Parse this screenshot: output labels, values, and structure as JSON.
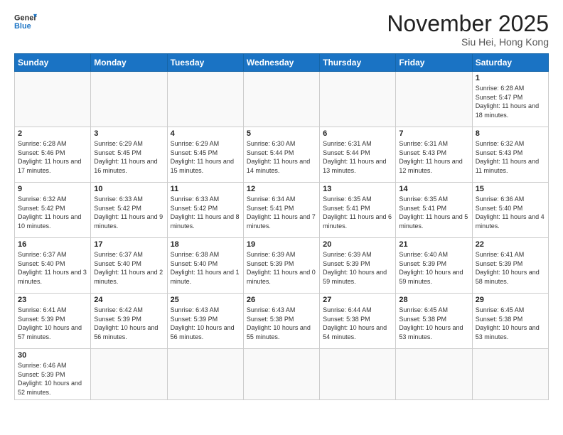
{
  "header": {
    "logo": "GeneralBlue",
    "title": "November 2025",
    "location": "Siu Hei, Hong Kong"
  },
  "days_of_week": [
    "Sunday",
    "Monday",
    "Tuesday",
    "Wednesday",
    "Thursday",
    "Friday",
    "Saturday"
  ],
  "weeks": [
    [
      {
        "day": "",
        "info": ""
      },
      {
        "day": "",
        "info": ""
      },
      {
        "day": "",
        "info": ""
      },
      {
        "day": "",
        "info": ""
      },
      {
        "day": "",
        "info": ""
      },
      {
        "day": "",
        "info": ""
      },
      {
        "day": "1",
        "info": "Sunrise: 6:28 AM\nSunset: 5:47 PM\nDaylight: 11 hours and 18 minutes."
      }
    ],
    [
      {
        "day": "2",
        "info": "Sunrise: 6:28 AM\nSunset: 5:46 PM\nDaylight: 11 hours and 17 minutes."
      },
      {
        "day": "3",
        "info": "Sunrise: 6:29 AM\nSunset: 5:45 PM\nDaylight: 11 hours and 16 minutes."
      },
      {
        "day": "4",
        "info": "Sunrise: 6:29 AM\nSunset: 5:45 PM\nDaylight: 11 hours and 15 minutes."
      },
      {
        "day": "5",
        "info": "Sunrise: 6:30 AM\nSunset: 5:44 PM\nDaylight: 11 hours and 14 minutes."
      },
      {
        "day": "6",
        "info": "Sunrise: 6:31 AM\nSunset: 5:44 PM\nDaylight: 11 hours and 13 minutes."
      },
      {
        "day": "7",
        "info": "Sunrise: 6:31 AM\nSunset: 5:43 PM\nDaylight: 11 hours and 12 minutes."
      },
      {
        "day": "8",
        "info": "Sunrise: 6:32 AM\nSunset: 5:43 PM\nDaylight: 11 hours and 11 minutes."
      }
    ],
    [
      {
        "day": "9",
        "info": "Sunrise: 6:32 AM\nSunset: 5:42 PM\nDaylight: 11 hours and 10 minutes."
      },
      {
        "day": "10",
        "info": "Sunrise: 6:33 AM\nSunset: 5:42 PM\nDaylight: 11 hours and 9 minutes."
      },
      {
        "day": "11",
        "info": "Sunrise: 6:33 AM\nSunset: 5:42 PM\nDaylight: 11 hours and 8 minutes."
      },
      {
        "day": "12",
        "info": "Sunrise: 6:34 AM\nSunset: 5:41 PM\nDaylight: 11 hours and 7 minutes."
      },
      {
        "day": "13",
        "info": "Sunrise: 6:35 AM\nSunset: 5:41 PM\nDaylight: 11 hours and 6 minutes."
      },
      {
        "day": "14",
        "info": "Sunrise: 6:35 AM\nSunset: 5:41 PM\nDaylight: 11 hours and 5 minutes."
      },
      {
        "day": "15",
        "info": "Sunrise: 6:36 AM\nSunset: 5:40 PM\nDaylight: 11 hours and 4 minutes."
      }
    ],
    [
      {
        "day": "16",
        "info": "Sunrise: 6:37 AM\nSunset: 5:40 PM\nDaylight: 11 hours and 3 minutes."
      },
      {
        "day": "17",
        "info": "Sunrise: 6:37 AM\nSunset: 5:40 PM\nDaylight: 11 hours and 2 minutes."
      },
      {
        "day": "18",
        "info": "Sunrise: 6:38 AM\nSunset: 5:40 PM\nDaylight: 11 hours and 1 minute."
      },
      {
        "day": "19",
        "info": "Sunrise: 6:39 AM\nSunset: 5:39 PM\nDaylight: 11 hours and 0 minutes."
      },
      {
        "day": "20",
        "info": "Sunrise: 6:39 AM\nSunset: 5:39 PM\nDaylight: 10 hours and 59 minutes."
      },
      {
        "day": "21",
        "info": "Sunrise: 6:40 AM\nSunset: 5:39 PM\nDaylight: 10 hours and 59 minutes."
      },
      {
        "day": "22",
        "info": "Sunrise: 6:41 AM\nSunset: 5:39 PM\nDaylight: 10 hours and 58 minutes."
      }
    ],
    [
      {
        "day": "23",
        "info": "Sunrise: 6:41 AM\nSunset: 5:39 PM\nDaylight: 10 hours and 57 minutes."
      },
      {
        "day": "24",
        "info": "Sunrise: 6:42 AM\nSunset: 5:39 PM\nDaylight: 10 hours and 56 minutes."
      },
      {
        "day": "25",
        "info": "Sunrise: 6:43 AM\nSunset: 5:39 PM\nDaylight: 10 hours and 56 minutes."
      },
      {
        "day": "26",
        "info": "Sunrise: 6:43 AM\nSunset: 5:38 PM\nDaylight: 10 hours and 55 minutes."
      },
      {
        "day": "27",
        "info": "Sunrise: 6:44 AM\nSunset: 5:38 PM\nDaylight: 10 hours and 54 minutes."
      },
      {
        "day": "28",
        "info": "Sunrise: 6:45 AM\nSunset: 5:38 PM\nDaylight: 10 hours and 53 minutes."
      },
      {
        "day": "29",
        "info": "Sunrise: 6:45 AM\nSunset: 5:38 PM\nDaylight: 10 hours and 53 minutes."
      }
    ],
    [
      {
        "day": "30",
        "info": "Sunrise: 6:46 AM\nSunset: 5:39 PM\nDaylight: 10 hours and 52 minutes."
      },
      {
        "day": "",
        "info": ""
      },
      {
        "day": "",
        "info": ""
      },
      {
        "day": "",
        "info": ""
      },
      {
        "day": "",
        "info": ""
      },
      {
        "day": "",
        "info": ""
      },
      {
        "day": "",
        "info": ""
      }
    ]
  ]
}
